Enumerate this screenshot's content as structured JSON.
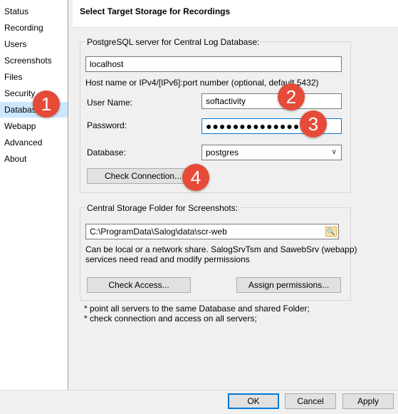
{
  "sidebar": {
    "items": [
      {
        "label": "Status"
      },
      {
        "label": "Recording"
      },
      {
        "label": "Users"
      },
      {
        "label": "Screenshots"
      },
      {
        "label": "Files"
      },
      {
        "label": "Security"
      },
      {
        "label": "Database"
      },
      {
        "label": "Webapp"
      },
      {
        "label": "Advanced"
      },
      {
        "label": "About"
      }
    ],
    "selected": "Database"
  },
  "header": {
    "title": "Select Target Storage for Recordings"
  },
  "db_group": {
    "label": "PostgreSQL server for Central Log Database:",
    "host_value": "localhost",
    "host_hint": "Host name or IPv4/[IPv6]:port number (optional, default 5432)",
    "username_label": "User Name:",
    "username_value": "softactivity",
    "password_label": "Password:",
    "password_value": "●●●●●●●●●●●●●●",
    "database_label": "Database:",
    "database_value": "postgres",
    "check_connection_label": "Check Connection..."
  },
  "folder_group": {
    "label": "Central Storage Folder for Screenshots:",
    "path_value": "C:\\ProgramData\\Salog\\data\\scr-web",
    "desc_line1": "Can be local or a network share. SalogSrvTsm and SawebSrv (webapp)",
    "desc_line2": "services need read and modify permissions",
    "check_access_label": "Check Access...",
    "assign_permissions_label": "Assign permissions..."
  },
  "notes": {
    "line1": "* point all servers to the same Database and shared Folder;",
    "line2": "* check connection and access on all servers;"
  },
  "footer": {
    "ok_label": "OK",
    "cancel_label": "Cancel",
    "apply_label": "Apply"
  },
  "badges": {
    "b1": "1",
    "b2": "2",
    "b3": "3",
    "b4": "4"
  },
  "colors": {
    "badge": "#e54b38",
    "selection": "#cce8ff",
    "focus": "#0078d7"
  }
}
